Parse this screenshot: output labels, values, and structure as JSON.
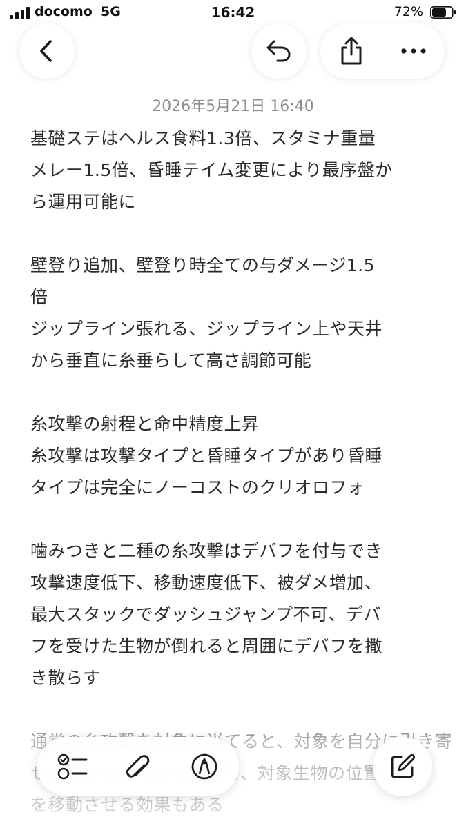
{
  "status_bar": {
    "carrier": "docomo",
    "network": "5G",
    "time": "16:42",
    "battery_percent": "72%",
    "battery_level": 0.72
  },
  "toolbar": {
    "back_icon": "chevron-left-icon",
    "undo_icon": "undo-icon",
    "share_icon": "share-icon",
    "more_icon": "ellipsis-icon"
  },
  "note": {
    "date": "2026年5月21日 16:40",
    "lines": [
      "基礎ステはヘルス食料1.3倍、スタミナ重量",
      "メレー1.5倍、昏睡テイム変更により最序盤か",
      "ら運用可能に",
      "",
      "壁登り追加、壁登り時全ての与ダメージ1.5",
      "倍",
      "ジップライン張れる、ジップライン上や天井",
      "から垂直に糸垂らして高さ調節可能",
      "",
      "糸攻撃の射程と命中精度上昇",
      "糸攻撃は攻撃タイプと昏睡タイプがあり昏睡",
      "タイプは完全にノーコストのクリオロフォ",
      "",
      "噛みつきと二種の糸攻撃はデバフを付与でき",
      "攻撃速度低下、移動速度低下、被ダメ増加、",
      "最大スタックでダッシュジャンプ不可、デバ",
      "フを受けた生物が倒れると周囲にデバフを撒",
      "き散らす",
      "",
      "通常の糸攻撃を対象に当てると、対象を自分に引き寄",
      "せる事が出来るのに加えて、対象生物の位置",
      "を移動させる効果もある"
    ]
  },
  "bottom_toolbar": {
    "checklist_icon": "checklist-icon",
    "attachment_icon": "paperclip-icon",
    "markup_icon": "markup-pen-icon",
    "compose_icon": "compose-icon"
  },
  "colors": {
    "text": "#2b2b2b",
    "date": "#8e8e93",
    "icon": "#1c1c1e",
    "background": "#ffffff"
  }
}
